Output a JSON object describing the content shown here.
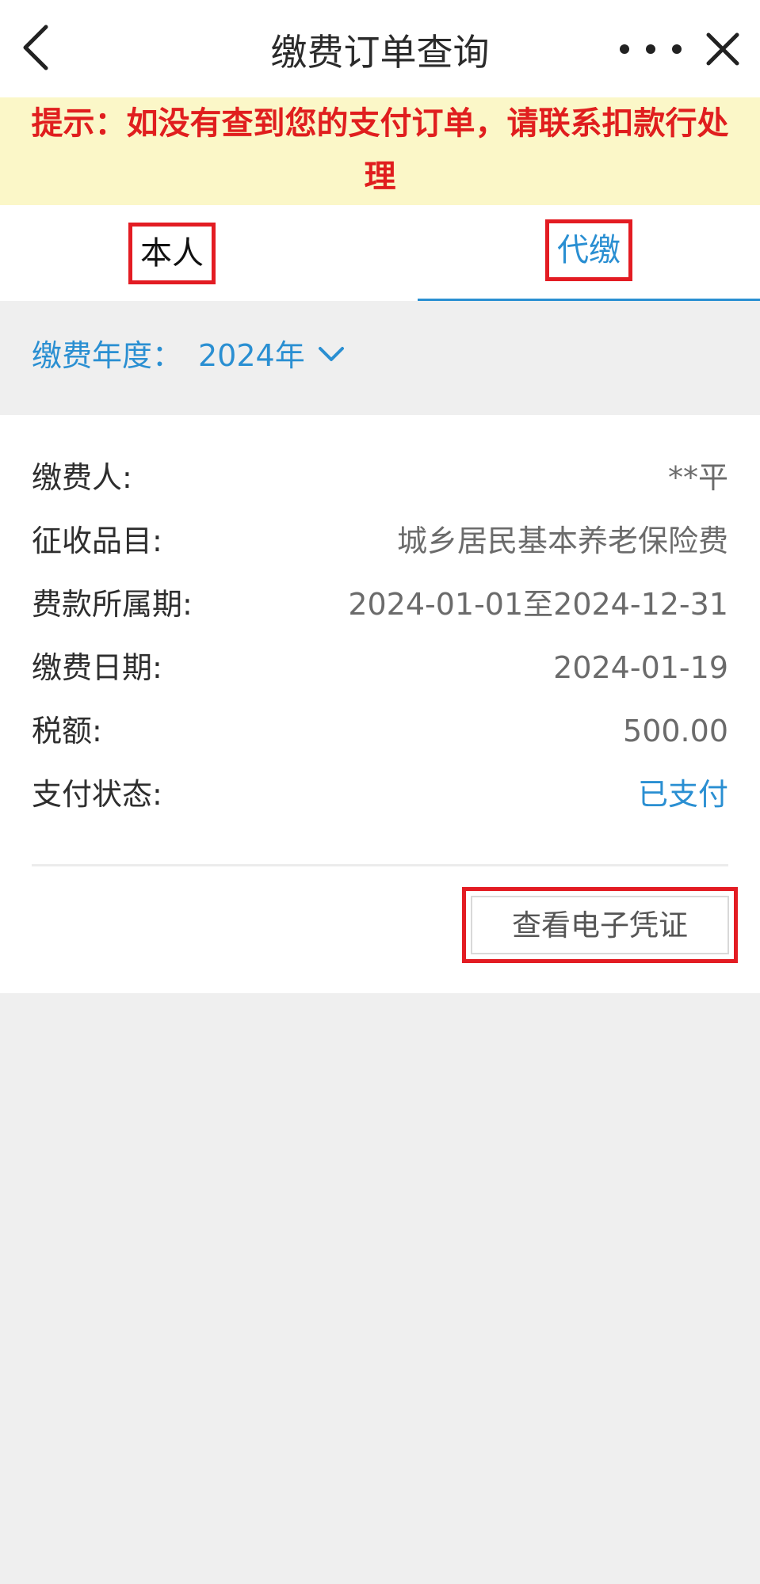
{
  "header": {
    "title": "缴费订单查询",
    "back_icon": "chevron-left-icon",
    "more_icon": "more-dots-icon",
    "close_icon": "close-icon"
  },
  "notice": {
    "line1": "提示：如没有查到您的支付订单，请联系扣款行处",
    "line2": "理"
  },
  "tabs": [
    {
      "label": "本人",
      "active": false
    },
    {
      "label": "代缴",
      "active": true
    }
  ],
  "filter": {
    "label": "缴费年度：",
    "value": "2024年"
  },
  "order": {
    "fields": [
      {
        "label": "缴费人:",
        "value": "**平"
      },
      {
        "label": "征收品目:",
        "value": "城乡居民基本养老保险费"
      },
      {
        "label": "费款所属期:",
        "value": "2024-01-01至2024-12-31"
      },
      {
        "label": "缴费日期:",
        "value": "2024-01-19"
      },
      {
        "label": "税额:",
        "value": "500.00"
      },
      {
        "label": "支付状态:",
        "value": "已支付"
      }
    ],
    "voucher_button": "查看电子凭证"
  },
  "colors": {
    "accent": "#2a8fd2",
    "notice_text": "#e01e1e",
    "notice_bg": "#fbf7c8",
    "highlight_box": "#e31c23",
    "page_bg": "#efefef"
  }
}
